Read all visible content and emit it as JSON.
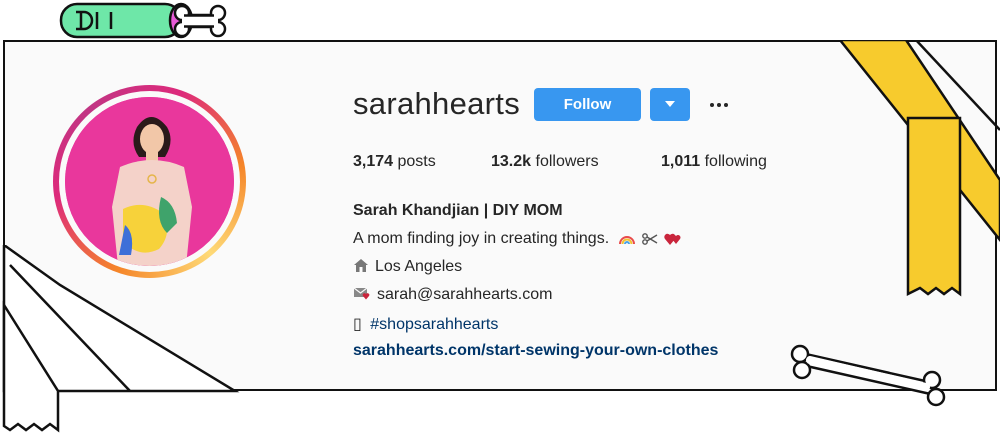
{
  "profile": {
    "username": "sarahhearts",
    "follow_label": "Follow",
    "more_label": "•••",
    "stats": {
      "posts_count": "3,174",
      "posts_label": "posts",
      "followers_count": "13.2k",
      "followers_label": "followers",
      "following_count": "1,011",
      "following_label": "following"
    },
    "full_name": "Sarah Khandjian | DIY MOM",
    "bio": "A mom finding joy in creating things.",
    "location": "Los Angeles",
    "email": "sarah@sarahhearts.com",
    "hashtag_icon": "▯",
    "hashtag": "#shopsarahhearts",
    "website": "sarahhearts.com/start-sewing-your-own-clothes"
  },
  "colors": {
    "follow_blue": "#3897f0",
    "link_blue": "#003569",
    "ribbon_yellow": "#f7cb2d",
    "tube_green": "#6ee7a8",
    "tube_pink": "#e85ad8",
    "photo_pink": "#e9379c"
  },
  "icons": [
    "bandage-tube-icon",
    "bone-icon",
    "house-icon",
    "envelope-heart-icon",
    "rainbow-icon",
    "scissors-icon",
    "heart-icon",
    "chevron-down-icon",
    "ellipsis-icon"
  ]
}
